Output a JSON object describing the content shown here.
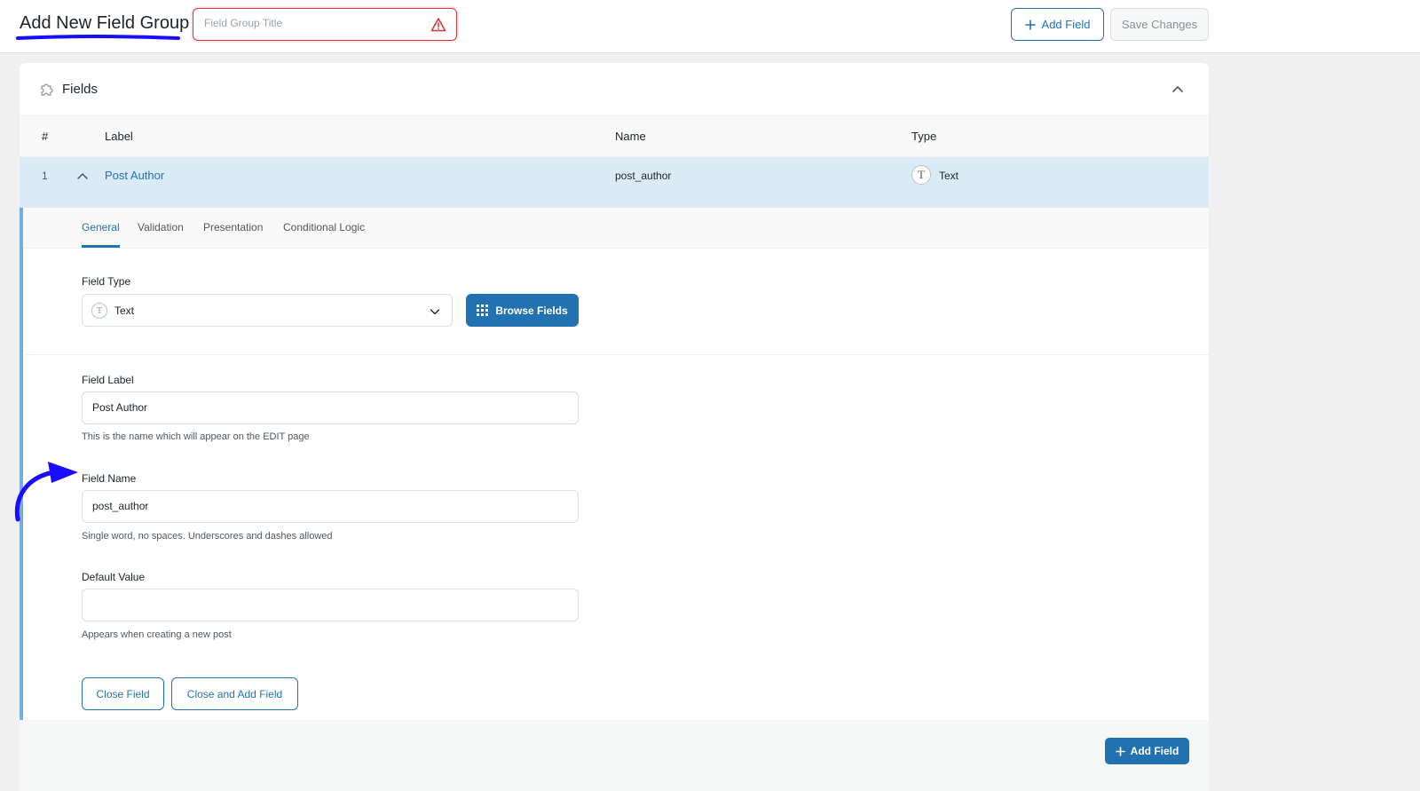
{
  "header": {
    "page_title": "Add New Field Group",
    "title_placeholder": "Field Group Title",
    "add_field_label": "Add Field",
    "save_changes_label": "Save Changes"
  },
  "panel": {
    "title": "Fields",
    "columns": [
      "#",
      "Label",
      "Name",
      "Type"
    ],
    "field_row": {
      "number": "1",
      "label": "Post Author",
      "name": "post_author",
      "type_icon": "T",
      "type": "Text"
    },
    "tabs": [
      "General",
      "Validation",
      "Presentation",
      "Conditional Logic"
    ],
    "active_tab": "General",
    "field_type": {
      "label": "Field Type",
      "icon": "T",
      "value": "Text",
      "browse_label": "Browse Fields"
    },
    "field_label": {
      "label": "Field Label",
      "value": "Post Author",
      "help": "This is the name which will appear on the EDIT page"
    },
    "field_name": {
      "label": "Field Name",
      "value": "post_author",
      "help": "Single word, no spaces. Underscores and dashes allowed"
    },
    "default_value": {
      "label": "Default Value",
      "value": "",
      "help": "Appears when creating a new post"
    },
    "close_field_label": "Close Field",
    "close_add_label": "Close and Add Field",
    "footer_add_label": "Add Field"
  },
  "colors": {
    "accent": "#2271b1",
    "row_highlight": "#dbebf5",
    "error": "#d63638",
    "annotation": "#1a0dff"
  }
}
